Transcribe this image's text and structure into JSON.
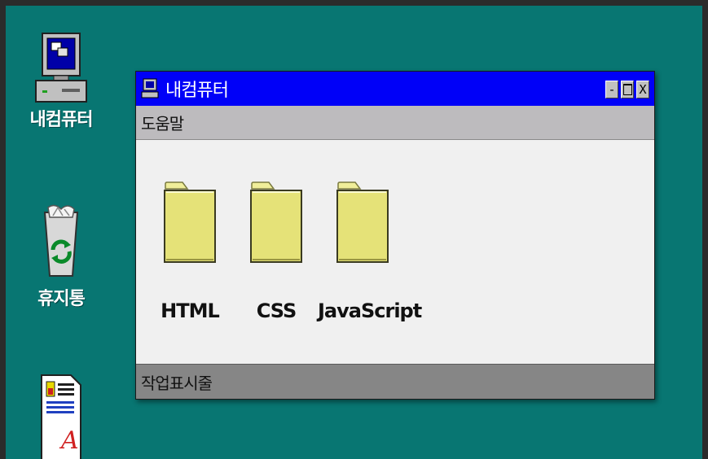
{
  "desktop": {
    "icons": [
      {
        "label": "내컴퓨터",
        "icon": "my-computer-icon"
      },
      {
        "label": "휴지통",
        "icon": "recycle-bin-icon"
      },
      {
        "label": "",
        "icon": "document-icon"
      }
    ]
  },
  "window": {
    "title": "내컴퓨터",
    "controls": {
      "minimize": "-",
      "close": "X"
    },
    "menu": [
      {
        "label": "도움말"
      }
    ],
    "folders": [
      {
        "label": "HTML"
      },
      {
        "label": "CSS"
      },
      {
        "label": "JavaScript"
      }
    ],
    "status": "작업표시줄"
  },
  "colors": {
    "desktop": "#087672",
    "titlebar": "#0000f8",
    "menubar": "#bdbbbe",
    "statusbar": "#868686",
    "folder": "#e5e278"
  }
}
